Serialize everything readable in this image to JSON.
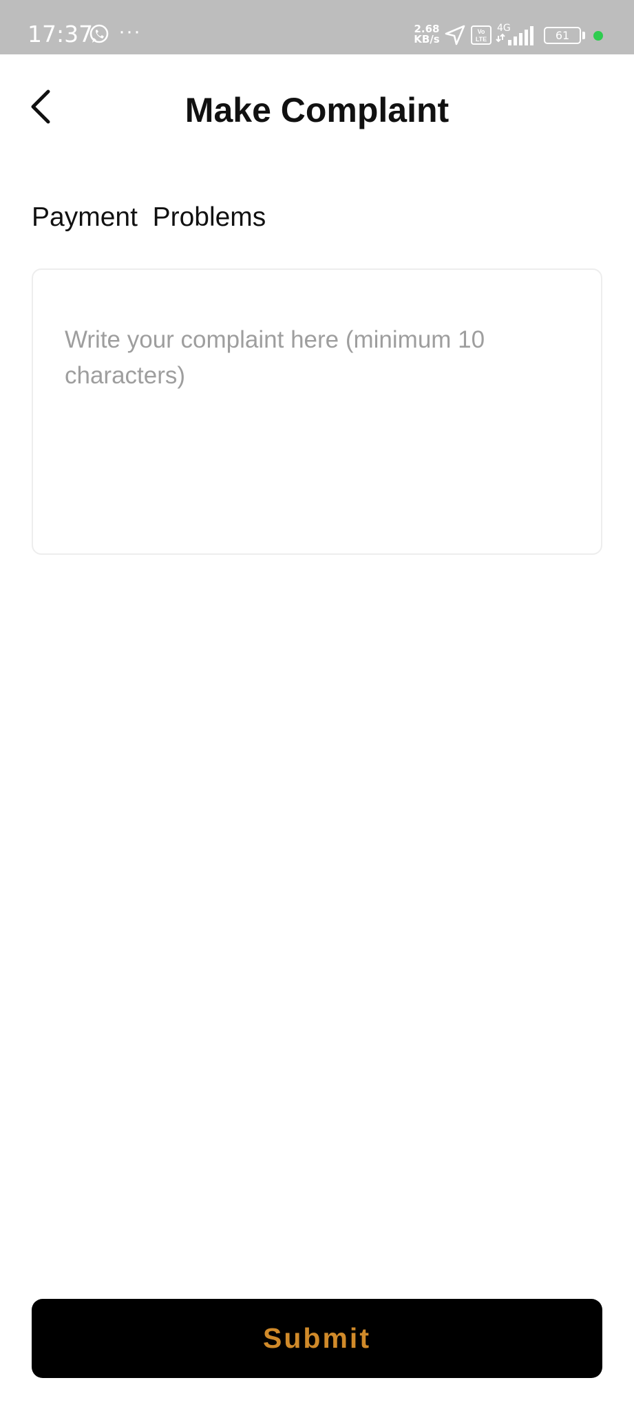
{
  "status_bar": {
    "time": "17:37",
    "more_indicator": "···",
    "net_speed_value": "2.68",
    "net_speed_unit": "KB/s",
    "volte_label": "Vo LTE",
    "network_type": "4G",
    "battery_level": "61",
    "icons": [
      "whatsapp-icon",
      "location-arrow-icon",
      "volte-icon",
      "signal-icon",
      "battery-icon",
      "privacy-dot-icon"
    ],
    "privacy_dot_color": "#2ecc4f"
  },
  "header": {
    "title": "Make Complaint",
    "back_icon": "chevron-left-icon"
  },
  "form": {
    "category": "Payment  Problems",
    "complaint_placeholder": "Write your complaint here (minimum 10 characters)",
    "complaint_value": ""
  },
  "footer": {
    "submit_label": "Submit",
    "submit_bg_color": "#000000",
    "submit_text_color": "#d08a2a"
  }
}
